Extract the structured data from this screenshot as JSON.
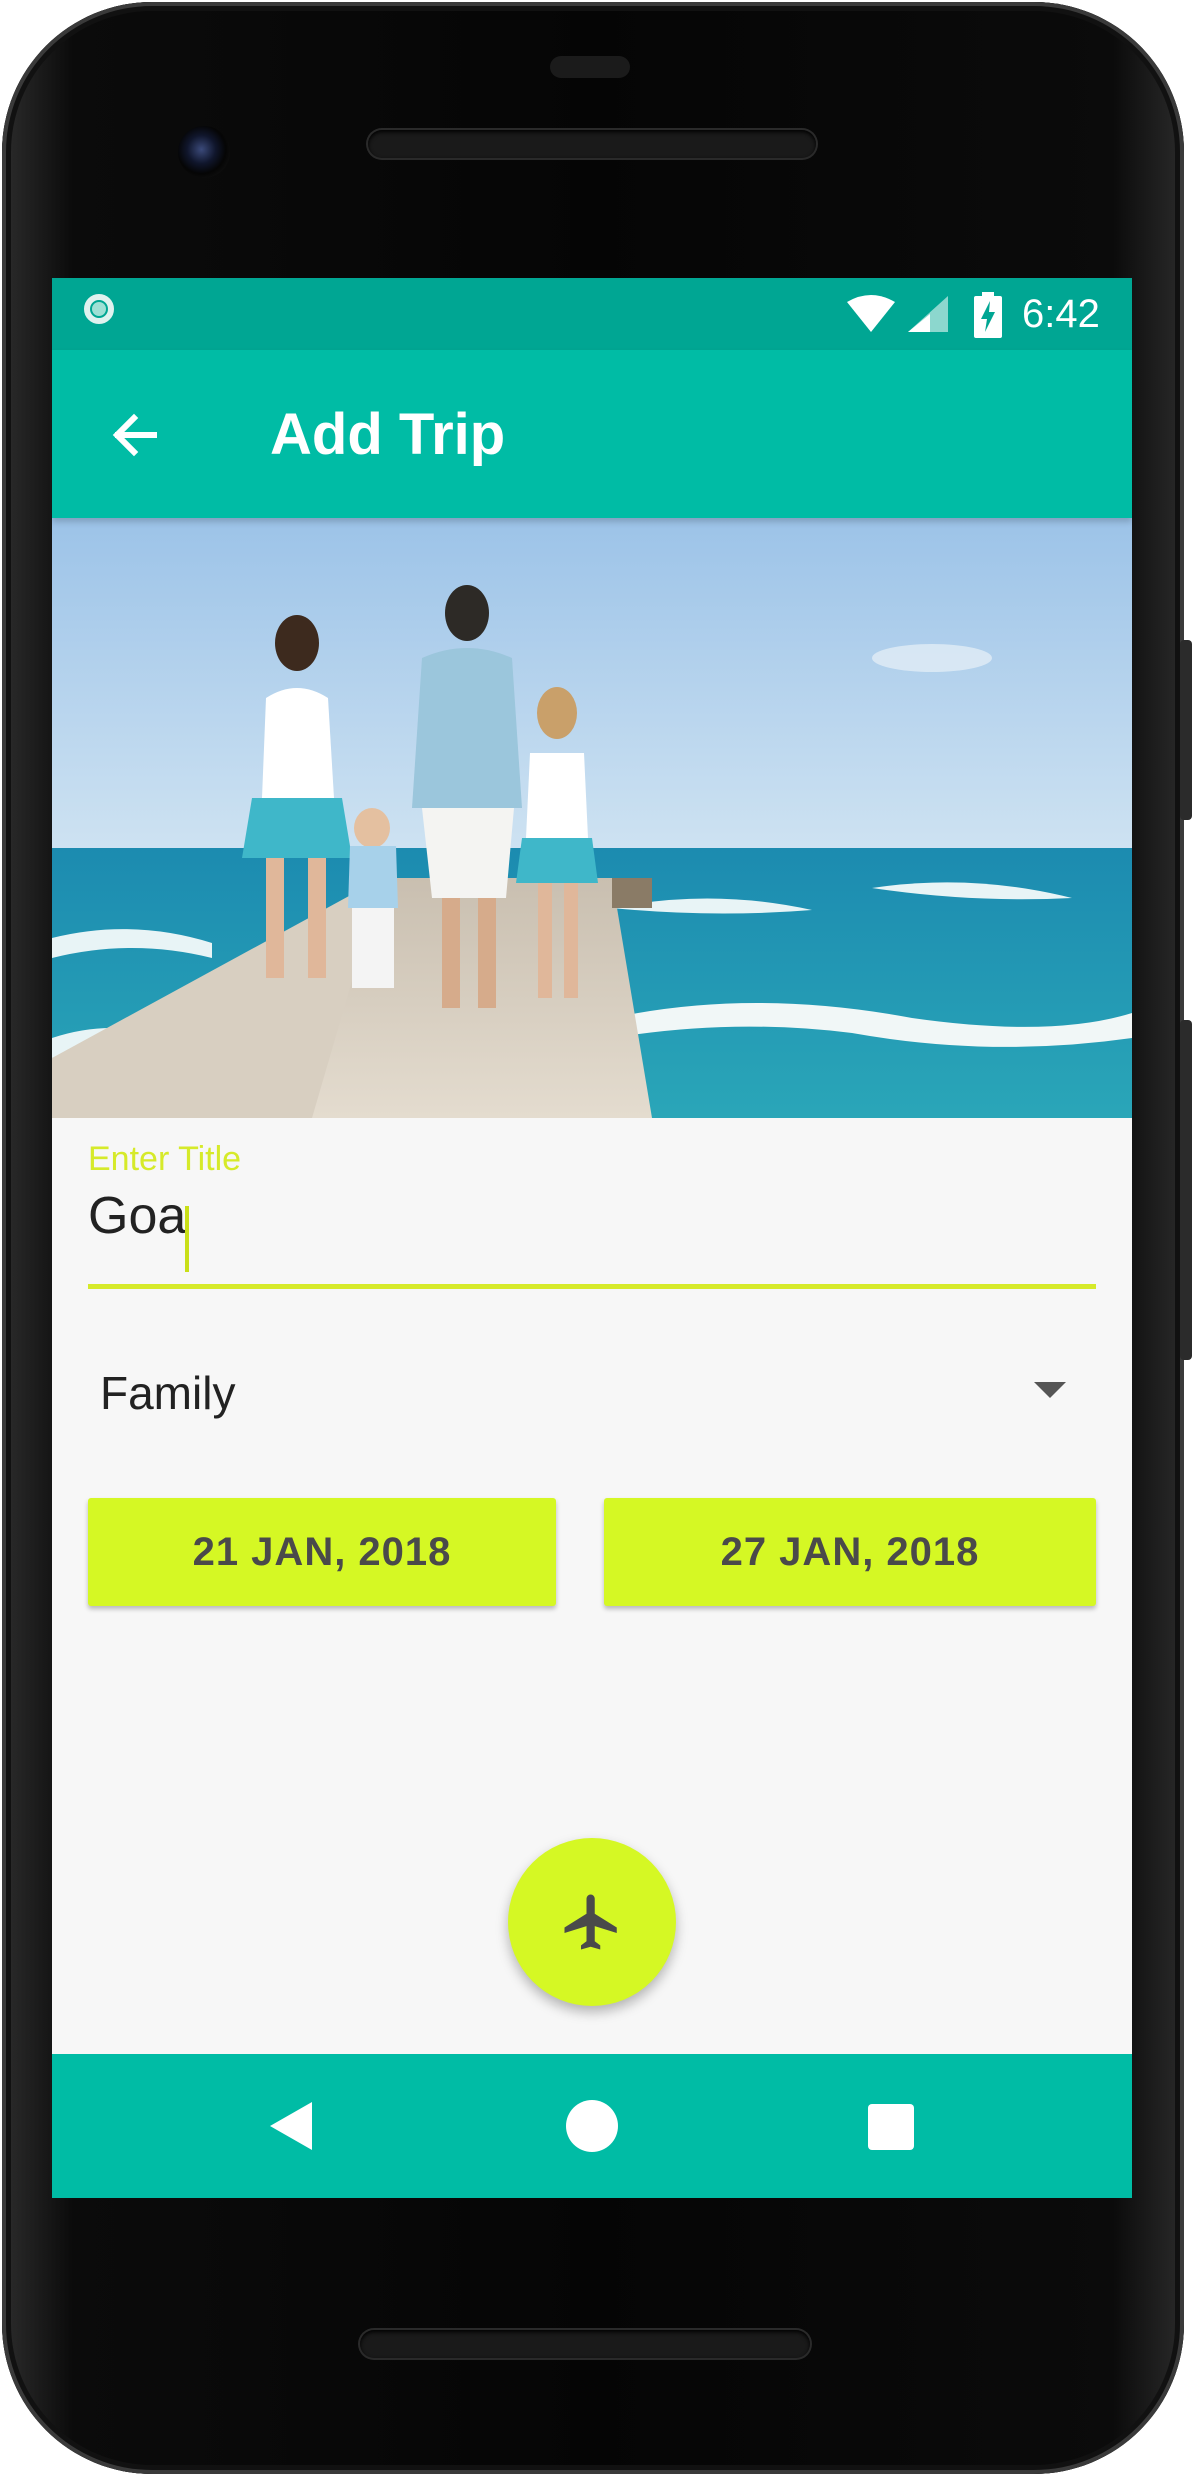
{
  "status_bar": {
    "time": "6:42",
    "icons": [
      "notification-ring-icon",
      "wifi-icon",
      "signal-icon",
      "battery-charging-icon"
    ],
    "color": "#00a693"
  },
  "app_bar": {
    "title": "Add Trip",
    "back_icon": "arrow-back-icon",
    "color": "#00bca5"
  },
  "hero": {
    "description_icon": "beach-family-photo"
  },
  "form": {
    "title_label": "Enter Title",
    "title_value": "Goa",
    "trip_type": "Family",
    "start_date": "21 JAN, 2018",
    "end_date": "27 JAN, 2018",
    "accent_color": "#d5f824"
  },
  "fab": {
    "icon": "airplane-icon"
  },
  "nav_bar": {
    "icons": [
      "nav-back-icon",
      "nav-home-icon",
      "nav-recents-icon"
    ]
  }
}
